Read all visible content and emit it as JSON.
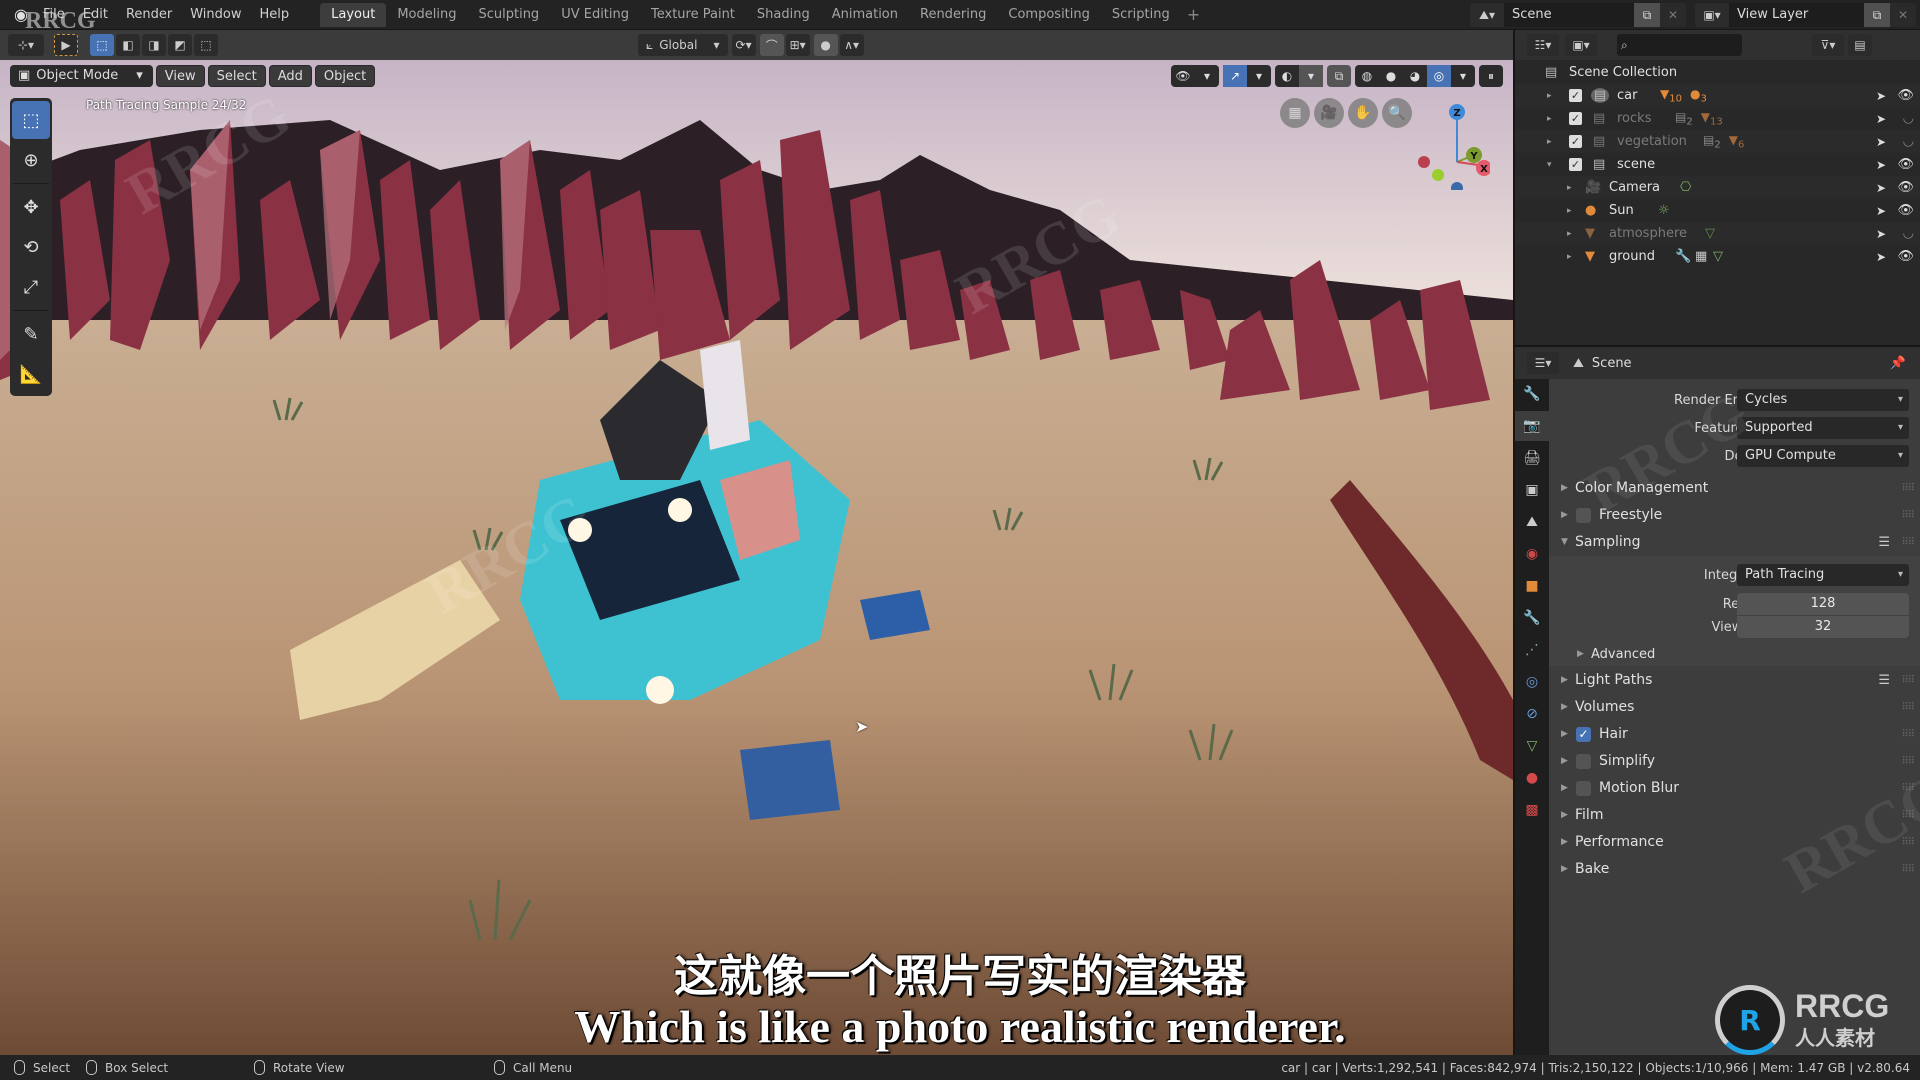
{
  "topbar": {
    "menus": [
      "File",
      "Edit",
      "Render",
      "Window",
      "Help"
    ],
    "workspaces": [
      "Layout",
      "Modeling",
      "Sculpting",
      "UV Editing",
      "Texture Paint",
      "Shading",
      "Animation",
      "Rendering",
      "Compositing",
      "Scripting"
    ],
    "active_workspace": "Layout",
    "add_workspace": "+",
    "scene_name": "Scene",
    "view_layer_name": "View Layer"
  },
  "tool_header": {
    "transform_orientation": "Global"
  },
  "viewport": {
    "mode": "Object Mode",
    "menus": [
      "View",
      "Select",
      "Add",
      "Object"
    ],
    "sample_text": "Path Tracing Sample 24/32",
    "gizmo_axes": {
      "z": "Z",
      "y": "Y",
      "x": "X"
    }
  },
  "subtitles": {
    "chinese": "这就像一个照片写实的渲染器",
    "english": "Which is like a photo realistic renderer."
  },
  "outliner": {
    "root": "Scene Collection",
    "rows": [
      {
        "label": "car",
        "expand": "▸",
        "checked": true,
        "badges": [
          "10",
          "3"
        ],
        "dim": false,
        "visible": true
      },
      {
        "label": "rocks",
        "expand": "▸",
        "checked": true,
        "badges": [
          "2",
          "13"
        ],
        "dim": true,
        "visible": false
      },
      {
        "label": "vegetation",
        "expand": "▸",
        "checked": true,
        "badges": [
          "2",
          "6"
        ],
        "dim": true,
        "visible": false
      },
      {
        "label": "scene",
        "expand": "▾",
        "checked": true,
        "badges": [],
        "dim": false,
        "visible": true
      },
      {
        "label": "Camera",
        "expand": "▸",
        "dim": false,
        "visible": true
      },
      {
        "label": "Sun",
        "expand": "▸",
        "dim": false,
        "visible": true
      },
      {
        "label": "atmosphere",
        "expand": "▸",
        "dim": true,
        "visible": false
      },
      {
        "label": "ground",
        "expand": "▸",
        "dim": false,
        "visible": true
      }
    ]
  },
  "properties": {
    "context": "Scene",
    "render_engine_label": "Render Engine",
    "render_engine": "Cycles",
    "feature_set_label": "Feature Set",
    "feature_set": "Supported",
    "device_label": "Device",
    "device": "GPU Compute",
    "panels": {
      "color_management": "Color Management",
      "freestyle": "Freestyle",
      "sampling": "Sampling",
      "advanced": "Advanced",
      "light_paths": "Light Paths",
      "volumes": "Volumes",
      "hair": "Hair",
      "simplify": "Simplify",
      "motion_blur": "Motion Blur",
      "film": "Film",
      "performance": "Performance",
      "bake": "Bake"
    },
    "freestyle_enabled": false,
    "hair_enabled": true,
    "simplify_enabled": false,
    "motion_blur_enabled": false,
    "integrator_label": "Integrator",
    "integrator": "Path Tracing",
    "render_samples_label": "Render",
    "render_samples": "128",
    "viewport_samples_label": "Viewport",
    "viewport_samples": "32"
  },
  "statusbar": {
    "select": "Select",
    "box_select": "Box Select",
    "rotate_view": "Rotate View",
    "call_menu": "Call Menu",
    "stats": "car | car | Verts:1,292,541 | Faces:842,974 | Tris:2,150,122 | Objects:1/10,966 | Mem: 1.47 GB | v2.80.64"
  },
  "watermark": {
    "brand": "RRCG",
    "brand_cn": "人人素材",
    "corner": "RRCG"
  }
}
